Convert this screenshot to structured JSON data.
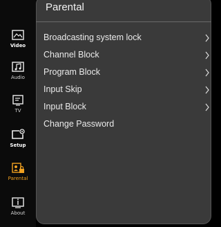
{
  "sidebar": {
    "items": [
      {
        "label": "Video",
        "icon": "video-icon"
      },
      {
        "label": "Audio",
        "icon": "audio-icon"
      },
      {
        "label": "TV",
        "icon": "tv-icon"
      },
      {
        "label": "Setup",
        "icon": "setup-icon"
      },
      {
        "label": "Parental",
        "icon": "parental-lock-icon"
      },
      {
        "label": "About",
        "icon": "about-icon"
      }
    ],
    "active_color": "#f0a020"
  },
  "panel": {
    "title": "Parental",
    "items": [
      {
        "label": "Broadcasting system lock",
        "has_chevron": true
      },
      {
        "label": "Channel Block",
        "has_chevron": true
      },
      {
        "label": "Program Block",
        "has_chevron": true
      },
      {
        "label": "Input Skip",
        "has_chevron": true
      },
      {
        "label": "Input Block",
        "has_chevron": true
      },
      {
        "label": "Change Password",
        "has_chevron": false
      }
    ]
  }
}
